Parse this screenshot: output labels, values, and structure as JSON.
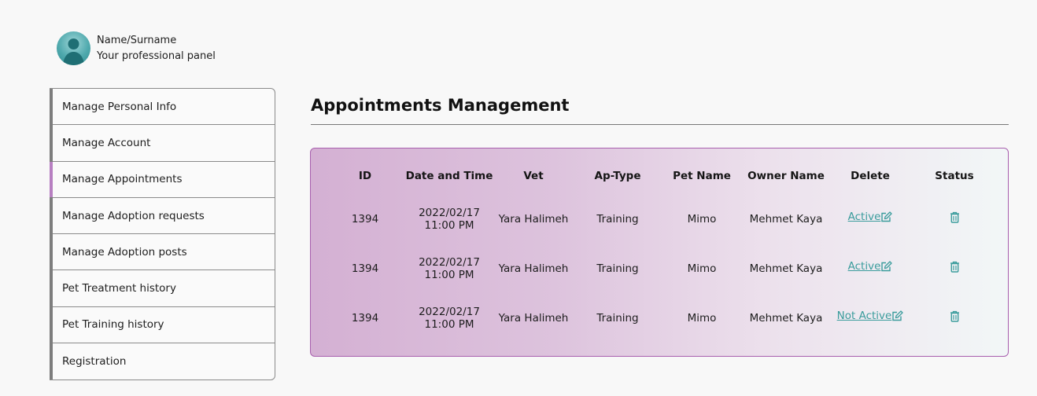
{
  "profile": {
    "name": "Name/Surname",
    "subtitle": "Your professional panel"
  },
  "sidebar": {
    "items": [
      {
        "label": "Manage Personal Info"
      },
      {
        "label": "Manage Account"
      },
      {
        "label": "Manage Appointments",
        "active": true
      },
      {
        "label": "Manage Adoption requests"
      },
      {
        "label": "Manage Adoption posts"
      },
      {
        "label": "Pet Treatment history"
      },
      {
        "label": "Pet Training history"
      },
      {
        "label": "Registration"
      }
    ]
  },
  "main": {
    "title": "Appointments Management"
  },
  "table": {
    "headers": [
      "ID",
      "Date and Time",
      "Vet",
      "Ap-Type",
      "Pet Name",
      "Owner Name",
      "Delete",
      "Status"
    ],
    "rows": [
      {
        "id": "1394",
        "date": "2022/02/17",
        "time": "11:00 PM",
        "vet": "Yara Halimeh",
        "type": "Training",
        "pet": "Mimo",
        "owner": "Mehmet Kaya",
        "status": "Active"
      },
      {
        "id": "1394",
        "date": "2022/02/17",
        "time": "11:00 PM",
        "vet": "Yara Halimeh",
        "type": "Training",
        "pet": "Mimo",
        "owner": "Mehmet Kaya",
        "status": "Active"
      },
      {
        "id": "1394",
        "date": "2022/02/17",
        "time": "11:00 PM",
        "vet": "Yara Halimeh",
        "type": "Training",
        "pet": "Mimo",
        "owner": "Mehmet Kaya",
        "status": "Not Active"
      }
    ]
  },
  "icons": {
    "avatar": "user-silhouette-icon",
    "edit": "edit-icon",
    "delete": "trash-icon"
  },
  "colors": {
    "accent": "#3a9c9c",
    "active_nav": "#b77fc1",
    "table_border": "#a85fae"
  }
}
